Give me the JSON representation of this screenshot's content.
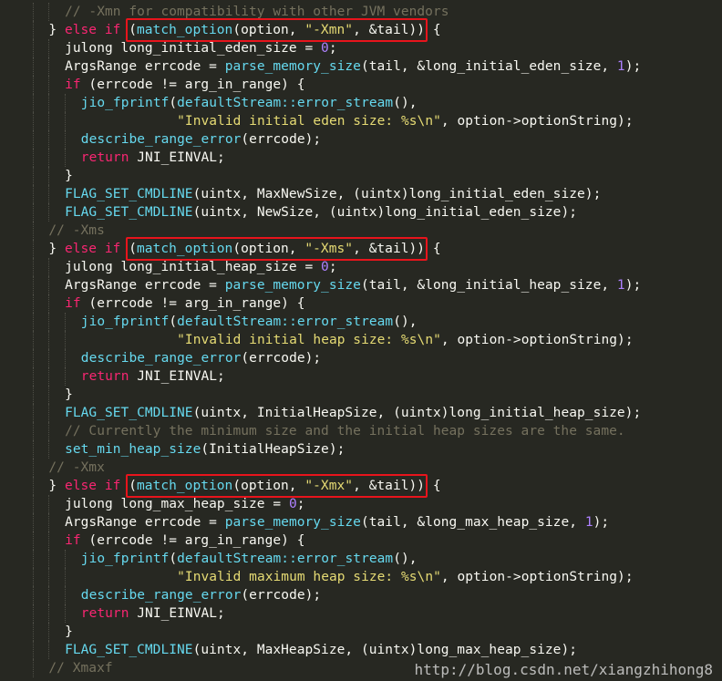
{
  "editor": {
    "colors": {
      "background": "#272822",
      "plain": "#f8f8f2",
      "comment": "#75715e",
      "keyword": "#f92672",
      "function": "#66d9ef",
      "string": "#e6db74",
      "number": "#ae81ff",
      "highlight_box": "#e8141c"
    },
    "lines": [
      {
        "indent": 3,
        "tokens": [
          [
            "comment",
            "// -Xmn for compatibility with other JVM vendors"
          ]
        ]
      },
      {
        "indent": 2,
        "tokens": [
          [
            "plain",
            "} "
          ],
          [
            "keyword",
            "else if"
          ],
          [
            "plain",
            " ("
          ],
          [
            "function",
            "match_option"
          ],
          [
            "plain",
            "(option, "
          ],
          [
            "string",
            "\"-Xmn\""
          ],
          [
            "plain",
            ", &tail)) {"
          ]
        ]
      },
      {
        "indent": 3,
        "tokens": [
          [
            "plain",
            "julong long_initial_eden_size = "
          ],
          [
            "number",
            "0"
          ],
          [
            "plain",
            ";"
          ]
        ]
      },
      {
        "indent": 3,
        "tokens": [
          [
            "plain",
            "ArgsRange errcode = "
          ],
          [
            "function",
            "parse_memory_size"
          ],
          [
            "plain",
            "(tail, &long_initial_eden_size, "
          ],
          [
            "number",
            "1"
          ],
          [
            "plain",
            ");"
          ]
        ]
      },
      {
        "indent": 3,
        "tokens": [
          [
            "keyword",
            "if"
          ],
          [
            "plain",
            " (errcode != arg_in_range) {"
          ]
        ]
      },
      {
        "indent": 4,
        "tokens": [
          [
            "function",
            "jio_fprintf"
          ],
          [
            "plain",
            "("
          ],
          [
            "function",
            "defaultStream::error_stream"
          ],
          [
            "plain",
            "(),"
          ]
        ]
      },
      {
        "indent": 4,
        "tokens": [
          [
            "plain",
            "            "
          ],
          [
            "string",
            "\"Invalid initial eden size: %s\\n\""
          ],
          [
            "plain",
            ", option->optionString);"
          ]
        ]
      },
      {
        "indent": 4,
        "tokens": [
          [
            "function",
            "describe_range_error"
          ],
          [
            "plain",
            "(errcode);"
          ]
        ]
      },
      {
        "indent": 4,
        "tokens": [
          [
            "keyword",
            "return"
          ],
          [
            "plain",
            " JNI_EINVAL;"
          ]
        ]
      },
      {
        "indent": 3,
        "tokens": [
          [
            "plain",
            "}"
          ]
        ]
      },
      {
        "indent": 3,
        "tokens": [
          [
            "function",
            "FLAG_SET_CMDLINE"
          ],
          [
            "plain",
            "(uintx, MaxNewSize, (uintx)long_initial_eden_size);"
          ]
        ]
      },
      {
        "indent": 3,
        "tokens": [
          [
            "function",
            "FLAG_SET_CMDLINE"
          ],
          [
            "plain",
            "(uintx, NewSize, (uintx)long_initial_eden_size);"
          ]
        ]
      },
      {
        "indent": 2,
        "tokens": [
          [
            "comment",
            "// -Xms"
          ]
        ]
      },
      {
        "indent": 2,
        "tokens": [
          [
            "plain",
            "} "
          ],
          [
            "keyword",
            "else if"
          ],
          [
            "plain",
            " ("
          ],
          [
            "function",
            "match_option"
          ],
          [
            "plain",
            "(option, "
          ],
          [
            "string",
            "\"-Xms\""
          ],
          [
            "plain",
            ", &tail)) {"
          ]
        ]
      },
      {
        "indent": 3,
        "tokens": [
          [
            "plain",
            "julong long_initial_heap_size = "
          ],
          [
            "number",
            "0"
          ],
          [
            "plain",
            ";"
          ]
        ]
      },
      {
        "indent": 3,
        "tokens": [
          [
            "plain",
            "ArgsRange errcode = "
          ],
          [
            "function",
            "parse_memory_size"
          ],
          [
            "plain",
            "(tail, &long_initial_heap_size, "
          ],
          [
            "number",
            "1"
          ],
          [
            "plain",
            ");"
          ]
        ]
      },
      {
        "indent": 3,
        "tokens": [
          [
            "keyword",
            "if"
          ],
          [
            "plain",
            " (errcode != arg_in_range) {"
          ]
        ]
      },
      {
        "indent": 4,
        "tokens": [
          [
            "function",
            "jio_fprintf"
          ],
          [
            "plain",
            "("
          ],
          [
            "function",
            "defaultStream::error_stream"
          ],
          [
            "plain",
            "(),"
          ]
        ]
      },
      {
        "indent": 4,
        "tokens": [
          [
            "plain",
            "            "
          ],
          [
            "string",
            "\"Invalid initial heap size: %s\\n\""
          ],
          [
            "plain",
            ", option->optionString);"
          ]
        ]
      },
      {
        "indent": 4,
        "tokens": [
          [
            "function",
            "describe_range_error"
          ],
          [
            "plain",
            "(errcode);"
          ]
        ]
      },
      {
        "indent": 4,
        "tokens": [
          [
            "keyword",
            "return"
          ],
          [
            "plain",
            " JNI_EINVAL;"
          ]
        ]
      },
      {
        "indent": 3,
        "tokens": [
          [
            "plain",
            "}"
          ]
        ]
      },
      {
        "indent": 3,
        "tokens": [
          [
            "function",
            "FLAG_SET_CMDLINE"
          ],
          [
            "plain",
            "(uintx, InitialHeapSize, (uintx)long_initial_heap_size);"
          ]
        ]
      },
      {
        "indent": 3,
        "tokens": [
          [
            "comment",
            "// Currently the minimum size and the initial heap sizes are the same."
          ]
        ]
      },
      {
        "indent": 3,
        "tokens": [
          [
            "function",
            "set_min_heap_size"
          ],
          [
            "plain",
            "(InitialHeapSize);"
          ]
        ]
      },
      {
        "indent": 2,
        "tokens": [
          [
            "comment",
            "// -Xmx"
          ]
        ]
      },
      {
        "indent": 2,
        "tokens": [
          [
            "plain",
            "} "
          ],
          [
            "keyword",
            "else if"
          ],
          [
            "plain",
            " ("
          ],
          [
            "function",
            "match_option"
          ],
          [
            "plain",
            "(option, "
          ],
          [
            "string",
            "\"-Xmx\""
          ],
          [
            "plain",
            ", &tail)) {"
          ]
        ]
      },
      {
        "indent": 3,
        "tokens": [
          [
            "plain",
            "julong long_max_heap_size = "
          ],
          [
            "number",
            "0"
          ],
          [
            "plain",
            ";"
          ]
        ]
      },
      {
        "indent": 3,
        "tokens": [
          [
            "plain",
            "ArgsRange errcode = "
          ],
          [
            "function",
            "parse_memory_size"
          ],
          [
            "plain",
            "(tail, &long_max_heap_size, "
          ],
          [
            "number",
            "1"
          ],
          [
            "plain",
            ");"
          ]
        ]
      },
      {
        "indent": 3,
        "tokens": [
          [
            "keyword",
            "if"
          ],
          [
            "plain",
            " (errcode != arg_in_range) {"
          ]
        ]
      },
      {
        "indent": 4,
        "tokens": [
          [
            "function",
            "jio_fprintf"
          ],
          [
            "plain",
            "("
          ],
          [
            "function",
            "defaultStream::error_stream"
          ],
          [
            "plain",
            "(),"
          ]
        ]
      },
      {
        "indent": 4,
        "tokens": [
          [
            "plain",
            "            "
          ],
          [
            "string",
            "\"Invalid maximum heap size: %s\\n\""
          ],
          [
            "plain",
            ", option->optionString);"
          ]
        ]
      },
      {
        "indent": 4,
        "tokens": [
          [
            "function",
            "describe_range_error"
          ],
          [
            "plain",
            "(errcode);"
          ]
        ]
      },
      {
        "indent": 4,
        "tokens": [
          [
            "keyword",
            "return"
          ],
          [
            "plain",
            " JNI_EINVAL;"
          ]
        ]
      },
      {
        "indent": 3,
        "tokens": [
          [
            "plain",
            "}"
          ]
        ]
      },
      {
        "indent": 3,
        "tokens": [
          [
            "function",
            "FLAG_SET_CMDLINE"
          ],
          [
            "plain",
            "(uintx, MaxHeapSize, (uintx)long_max_heap_size);"
          ]
        ]
      },
      {
        "indent": 2,
        "tokens": [
          [
            "comment",
            "// Xmaxf"
          ]
        ]
      }
    ],
    "highlighted_lines": [
      1,
      13,
      26
    ]
  },
  "watermark": {
    "text": "http://blog.csdn.net/xiangzhihong8"
  }
}
